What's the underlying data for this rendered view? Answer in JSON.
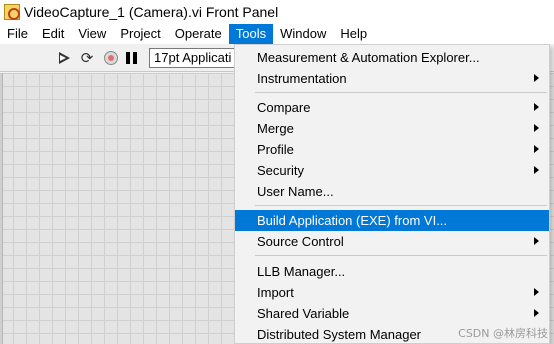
{
  "window": {
    "title": "VideoCapture_1 (Camera).vi Front Panel"
  },
  "menubar": {
    "items": [
      "File",
      "Edit",
      "View",
      "Project",
      "Operate",
      "Tools",
      "Window",
      "Help"
    ],
    "active": "Tools"
  },
  "toolbar": {
    "font_dropdown_value": "17pt Applicati"
  },
  "tools_menu": {
    "items": [
      {
        "label": "Measurement & Automation Explorer...",
        "submenu": false
      },
      {
        "label": "Instrumentation",
        "submenu": true
      },
      {
        "label": "Compare",
        "submenu": true
      },
      {
        "label": "Merge",
        "submenu": true
      },
      {
        "label": "Profile",
        "submenu": true
      },
      {
        "label": "Security",
        "submenu": true
      },
      {
        "label": "User Name...",
        "submenu": false
      },
      {
        "label": "Build Application (EXE) from VI...",
        "submenu": false,
        "highlighted": true
      },
      {
        "label": "Source Control",
        "submenu": true
      },
      {
        "label": "LLB Manager...",
        "submenu": false
      },
      {
        "label": "Import",
        "submenu": true
      },
      {
        "label": "Shared Variable",
        "submenu": true
      },
      {
        "label": "Distributed System Manager",
        "submenu": false
      }
    ]
  },
  "watermark": "CSDN @林房科技",
  "colors": {
    "highlight": "#0078d7",
    "menu_bg": "#f2f2f2",
    "grid_bg": "#e4e4e4"
  },
  "icons": [
    "labview-vi-icon",
    "run-arrow-icon",
    "run-continuously-icon",
    "abort-icon",
    "pause-icon",
    "submenu-arrow-icon"
  ]
}
